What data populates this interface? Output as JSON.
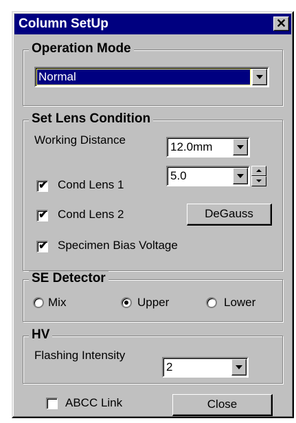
{
  "window": {
    "title": "Column SetUp"
  },
  "operation_mode": {
    "title": "Operation Mode",
    "selected": "Normal"
  },
  "lens": {
    "title": "Set Lens Condition",
    "working_distance_label": "Working Distance",
    "working_distance_value": "12.0mm",
    "cond_lens_1_label": "Cond Lens 1",
    "cond_lens_1_checked": true,
    "cond_lens_1_value": "5.0",
    "cond_lens_2_label": "Cond Lens 2",
    "cond_lens_2_checked": true,
    "degauss_label": "DeGauss",
    "specimen_bias_label": "Specimen Bias Voltage",
    "specimen_bias_checked": true
  },
  "se_detector": {
    "title": "SE Detector",
    "options": [
      "Mix",
      "Upper",
      "Lower"
    ],
    "selected": "Upper"
  },
  "hv": {
    "title": "HV",
    "flashing_label": "Flashing Intensity",
    "flashing_value": "2"
  },
  "footer": {
    "abcc_label": "ABCC Link",
    "abcc_checked": false,
    "close_label": "Close"
  },
  "icons": {
    "checkmark": "✔",
    "close": "✕"
  }
}
